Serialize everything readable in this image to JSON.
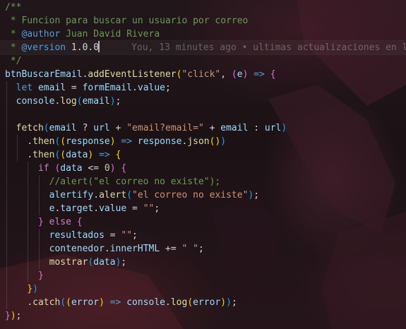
{
  "editor": {
    "blame": "You, 13 minutes ago • ultimas actualizaciones en lo",
    "lines": {
      "l1": "/**",
      "l2_text": " * Funcion para buscar un usuario por correo",
      "l3_star": " * ",
      "l3_tag": "@author",
      "l3_name": " Juan David Rivera",
      "l4_star": " * ",
      "l4_tag": "@version",
      "l4_ver": " 1.0.0",
      "l5": " */",
      "l6": {
        "obj": "btnBuscarEmail",
        "dot": ".",
        "method": "addEventListener",
        "str": "\"click\"",
        "comma": ", ",
        "param": "e",
        "arrow": " => "
      },
      "l7": {
        "kw": "let",
        "var": " email",
        "eq": " = ",
        "obj": "formEmail",
        "dot": ".",
        "prop": "value",
        "semi": ";"
      },
      "l8": {
        "obj": "console",
        "dot": ".",
        "fn": "log",
        "arg": "email",
        "semi": ";"
      },
      "l10": {
        "fn": "fetch",
        "v1": "email",
        "q": " ? ",
        "v2": "url",
        "plus1": " + ",
        "str": "\"email?email=\"",
        "plus2": " + ",
        "v3": "email",
        "colon": " : ",
        "v4": "url"
      },
      "l11": {
        "dot": ".",
        "fn": "then",
        "param": "response",
        "arrow": " => ",
        "obj": "response",
        "dot2": ".",
        "fn2": "json"
      },
      "l12": {
        "dot": ".",
        "fn": "then",
        "param": "data",
        "arrow": " => "
      },
      "l13": {
        "kw": "if",
        "var": "data",
        "op": " <= ",
        "num": "0"
      },
      "l14": "//alert(\"el correo no existe\");",
      "l15": {
        "obj": "alertify",
        "dot": ".",
        "fn": "alert",
        "str": "\"el correo no existe\"",
        "semi": ";"
      },
      "l16": {
        "obj": "e",
        "dot": ".",
        "prop1": "target",
        "dot2": ".",
        "prop2": "value",
        "eq": " = ",
        "str": "\"\"",
        "semi": ";"
      },
      "l17": {
        "close": "}",
        "kw": " else ",
        "open": "{"
      },
      "l18": {
        "var": "resultados",
        "eq": " = ",
        "str": "\"\"",
        "semi": ";"
      },
      "l19": {
        "obj": "contenedor",
        "dot": ".",
        "prop": "innerHTML",
        "op": " += ",
        "str": "\" \"",
        "semi": ";"
      },
      "l20": {
        "fn": "mostrar",
        "arg": "data",
        "semi": ";"
      },
      "l21": "}",
      "l22": ")",
      "l23": {
        "dot": ".",
        "fn": "catch",
        "param": "error",
        "arrow": " => ",
        "obj": "console",
        "dot2": ".",
        "fn2": "log",
        "arg": "error",
        "semi": ";"
      },
      "l24": {
        "close": "}",
        "paren": ")",
        "semi": ";"
      }
    }
  },
  "colors": {
    "comment": "#6a9955",
    "keyword": "#569cd6",
    "control": "#c586c0",
    "variable": "#9cdcfe",
    "function": "#dcdcaa",
    "string": "#ce9178",
    "number": "#b5cea8",
    "bracket_gold": "#ffd700",
    "bracket_orchid": "#da70d6",
    "bracket_blue": "#179fff"
  }
}
